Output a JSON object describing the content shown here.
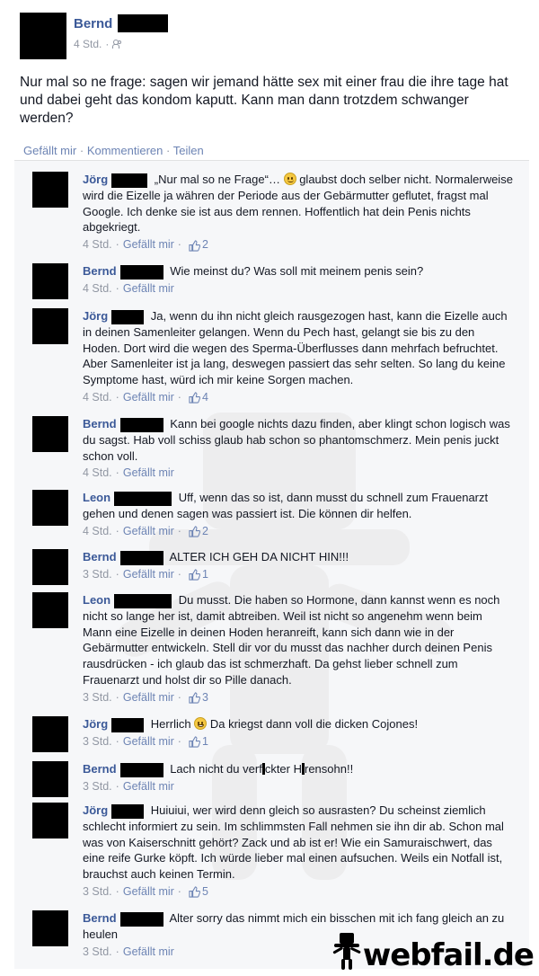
{
  "post": {
    "author": "Bernd",
    "time": "4 Std.",
    "audience_icon": "friends-icon",
    "text": "Nur mal so ne frage: sagen wir jemand hätte sex mit einer frau die ihre tage hat und dabei geht das kondom kaputt. Kann man dann trotzdem schwanger werden?",
    "actions": {
      "like": "Gefällt mir",
      "comment": "Kommentieren",
      "share": "Teilen",
      "separator": "·"
    }
  },
  "comments": [
    {
      "author": "Jörg",
      "pre": "„Nur mal so ne Frage“…",
      "emoji": "smile",
      "text": "glaubst doch selber nicht. Normalerweise wird die Eizelle ja währen der Periode aus der Gebärmutter geflutet, fragst mal Google. Ich denke sie ist aus dem rennen. Hoffentlich hat dein Penis nichts abgekriegt.",
      "time": "4 Std.",
      "like": "Gefällt mir",
      "likes": "2"
    },
    {
      "author": "Bernd",
      "text": "Wie meinst du? Was soll mit meinem penis sein?",
      "time": "4 Std.",
      "like": "Gefällt mir",
      "likes": ""
    },
    {
      "author": "Jörg",
      "text": "Ja, wenn du ihn nicht gleich rausgezogen hast, kann die Eizelle auch in deinen Samenleiter gelangen. Wenn du Pech hast, gelangt sie bis zu den Hoden. Dort wird die wegen des Sperma-Überflusses dann mehrfach befruchtet. Aber Samenleiter ist ja lang, deswegen passiert das sehr selten. So lang du keine Symptome hast, würd ich mir keine Sorgen machen.",
      "time": "4 Std.",
      "like": "Gefällt mir",
      "likes": "4"
    },
    {
      "author": "Bernd",
      "text": "Kann bei google nichts dazu finden, aber klingt schon logisch was du sagst. Hab voll schiss glaub hab schon so phantomschmerz. Mein penis juckt schon voll.",
      "time": "4 Std.",
      "like": "Gefällt mir",
      "likes": ""
    },
    {
      "author": "Leon",
      "text": "Uff, wenn das so ist, dann musst du schnell zum Frauenarzt gehen und denen sagen was passiert ist. Die können dir helfen.",
      "time": "4 Std.",
      "like": "Gefällt mir",
      "likes": "2"
    },
    {
      "author": "Bernd",
      "text": "ALTER ICH GEH DA NICHT HIN!!!",
      "time": "3 Std.",
      "like": "Gefällt mir",
      "likes": "1"
    },
    {
      "author": "Leon",
      "text": "Du musst. Die haben so Hormone, dann kannst wenn es noch nicht so lange her ist, damit abtreiben. Weil ist nicht so angenehm wenn beim Mann eine Eizelle in deinen Hoden heranreift, kann sich dann wie in der Gebärmutter entwickeln. Stell dir vor du musst das nachher durch deinen Penis rausdrücken - ich glaub das ist schmerzhaft. Da gehst lieber schnell zum Frauenarzt und holst dir so Pille danach.",
      "time": "3 Std.",
      "like": "Gefällt mir",
      "likes": "3"
    },
    {
      "author": "Jörg",
      "pre": "Herrlich",
      "emoji": "grin",
      "text": "Da kriegst dann voll die dicken Cojones!",
      "time": "3 Std.",
      "like": "Gefällt mir",
      "likes": "1"
    },
    {
      "author": "Bernd",
      "text_a": "Lach nicht du verf",
      "text_b": "ckter H",
      "text_c": "rensohn!!",
      "time": "3 Std.",
      "like": "Gefällt mir",
      "likes": ""
    },
    {
      "author": "Jörg",
      "text": "Huiuiui, wer wird denn gleich so ausrasten? Du scheinst ziemlich schlecht informiert zu sein. Im schlimmsten Fall nehmen sie ihn dir ab. Schon mal was von Kaiserschnitt gehört? Zack und ab ist er! Wie ein Samuraischwert, das eine reife Gurke köpft. Ich würde lieber mal einen aufsuchen. Weils ein Notfall ist, brauchst auch keinen Termin.",
      "time": "3 Std.",
      "like": "Gefällt mir",
      "likes": "5"
    },
    {
      "author": "Bernd",
      "text": "Alter sorry das nimmt mich ein bisschen mit ich fang gleich an zu heulen",
      "time": "3 Std.",
      "like": "Gefällt mir",
      "likes": ""
    }
  ],
  "icons": {
    "like": "thumbs-up-icon",
    "logo": "webfail-mascot-icon"
  },
  "logo": {
    "text": "webfail.de"
  },
  "colors": {
    "link": "#3b5998",
    "meta_link": "#6d84b4",
    "muted": "#9197a3",
    "comments_bg": "#f6f7f9"
  }
}
